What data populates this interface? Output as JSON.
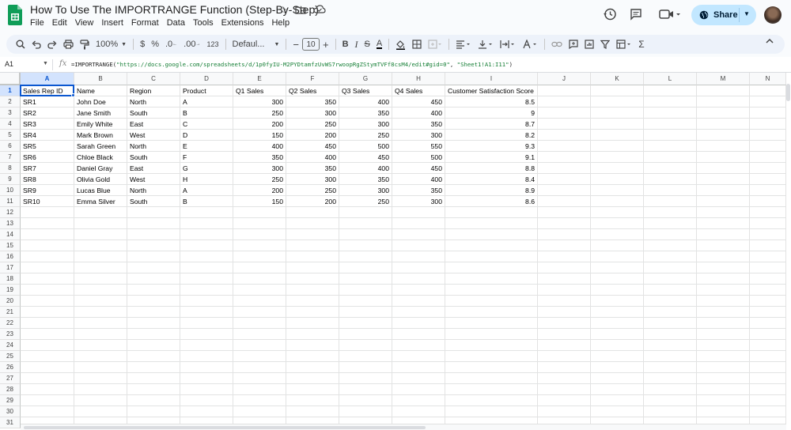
{
  "app": {
    "doc_title": "How To Use The IMPORTRANGE Function (Step-By-Step)",
    "menus": [
      "File",
      "Edit",
      "View",
      "Insert",
      "Format",
      "Data",
      "Tools",
      "Extensions",
      "Help"
    ],
    "share_label": "Share",
    "brand_color": "#0f9d58"
  },
  "toolbar": {
    "zoom": "100%",
    "currency": "$",
    "percent": "%",
    "decrease_decimal": ".0",
    "increase_decimal": ".00",
    "number_format": "123",
    "font": "Defaul...",
    "font_size": "10",
    "bold": "B",
    "italic": "I",
    "strike": "S",
    "text_color": "A",
    "sigma": "Σ"
  },
  "formula_bar": {
    "name_box": "A1",
    "fx": "fx",
    "func": "=IMPORTRANGE(",
    "arg1": "\"https://docs.google.com/spreadsheets/d/1p0fyIU-M2PYDtamfzUvWS7rwoopRgZStymTVFf8csM4/edit#gid=0\"",
    "comma": ", ",
    "arg2": "\"Sheet1!A1:I11\"",
    "close": ")"
  },
  "sheet": {
    "columns": [
      "A",
      "B",
      "C",
      "D",
      "E",
      "F",
      "G",
      "H",
      "I",
      "J",
      "K",
      "L",
      "M",
      "N"
    ],
    "row_numbers": [
      "1",
      "2",
      "3",
      "4",
      "5",
      "6",
      "7",
      "8",
      "9",
      "10",
      "11",
      "12",
      "13",
      "14",
      "15",
      "16",
      "17",
      "18",
      "19",
      "20",
      "21",
      "22",
      "23",
      "24",
      "25",
      "26",
      "27",
      "28",
      "29",
      "30",
      "31"
    ],
    "headers": [
      "Sales Rep ID",
      "Name",
      "Region",
      "Product",
      "Q1 Sales",
      "Q2 Sales",
      "Q3 Sales",
      "Q4 Sales",
      "Customer Satisfaction Score"
    ],
    "rows": [
      [
        "SR1",
        "John Doe",
        "North",
        "A",
        "300",
        "350",
        "400",
        "450",
        "8.5"
      ],
      [
        "SR2",
        "Jane Smith",
        "South",
        "B",
        "250",
        "300",
        "350",
        "400",
        "9"
      ],
      [
        "SR3",
        "Emily White",
        "East",
        "C",
        "200",
        "250",
        "300",
        "350",
        "8.7"
      ],
      [
        "SR4",
        "Mark Brown",
        "West",
        "D",
        "150",
        "200",
        "250",
        "300",
        "8.2"
      ],
      [
        "SR5",
        "Sarah Green",
        "North",
        "E",
        "400",
        "450",
        "500",
        "550",
        "9.3"
      ],
      [
        "SR6",
        "Chloe Black",
        "South",
        "F",
        "350",
        "400",
        "450",
        "500",
        "9.1"
      ],
      [
        "SR7",
        "Daniel Gray",
        "East",
        "G",
        "300",
        "350",
        "400",
        "450",
        "8.8"
      ],
      [
        "SR8",
        "Olivia Gold",
        "West",
        "H",
        "250",
        "300",
        "350",
        "400",
        "8.4"
      ],
      [
        "SR9",
        "Lucas Blue",
        "North",
        "A",
        "200",
        "250",
        "300",
        "350",
        "8.9"
      ],
      [
        "SR10",
        "Emma Silver",
        "South",
        "B",
        "150",
        "200",
        "250",
        "300",
        "8.6"
      ]
    ],
    "numeric_columns": [
      4,
      5,
      6,
      7,
      8
    ],
    "selected_cell": "A1"
  }
}
